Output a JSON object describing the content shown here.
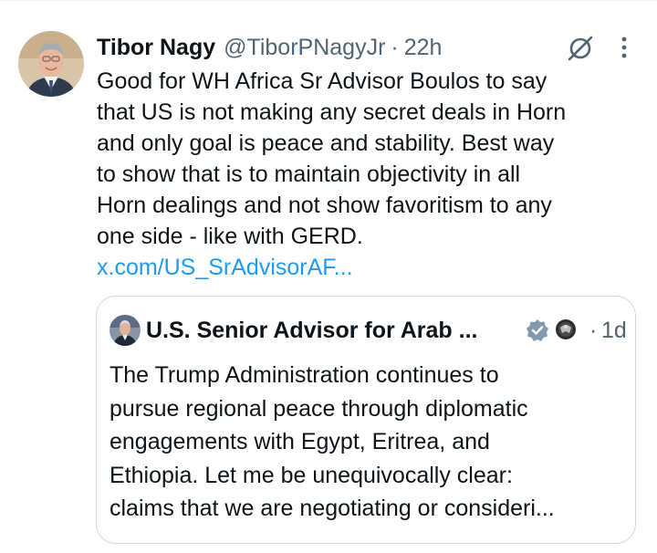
{
  "tweet": {
    "author_name": "Tibor Nagy",
    "author_handle": "@TiborPNagyJr",
    "separator": "·",
    "time": "22h",
    "body_lines": [
      "Good for WH Africa Sr Advisor Boulos to say",
      "that US is not making any secret deals in Horn",
      "and only goal is peace and stability. Best way",
      "to show that is to maintain objectivity in all",
      "Horn dealings and not show favoritism to any",
      "one side - like with GERD."
    ],
    "link": "x.com/US_SrAdvisorAF..."
  },
  "quoted_tweet": {
    "author_name": "U.S. Senior Advisor for Arab ...",
    "separator": "·",
    "time": "1d",
    "body_lines": [
      "The Trump Administration continues to",
      "pursue regional peace through diplomatic",
      "engagements with Egypt, Eritrea, and",
      "Ethiopia. Let me be unequivocally clear:",
      "claims that we are negotiating or consideri..."
    ]
  },
  "icons": {
    "grok": "grok-icon",
    "more": "more-options-icon",
    "verified": "verified-badge-icon",
    "seal": "government-seal-icon"
  },
  "colors": {
    "text": "#0f1419",
    "secondary": "#536471",
    "link": "#1d9bf0",
    "border": "#cfd9de",
    "verified_grey": "#829aab"
  }
}
